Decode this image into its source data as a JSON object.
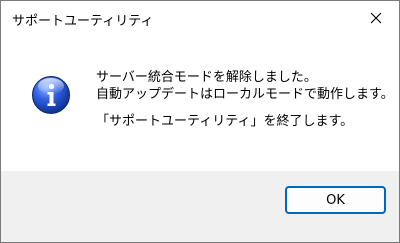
{
  "window": {
    "title": "サポートユーティリティ"
  },
  "message": {
    "line1": "サーバー統合モードを解除しました。",
    "line2": "自動アップデートはローカルモードで動作します。",
    "line3": "「サポートユーティリティ」を終了します。"
  },
  "buttons": {
    "ok_label": "OK"
  },
  "icons": {
    "dialog_icon": "information-icon",
    "close_icon": "close-icon"
  },
  "colors": {
    "accent": "#0067c0",
    "footer_bg": "#f0f0f0",
    "info_icon_blue": "#1f4fcf"
  }
}
